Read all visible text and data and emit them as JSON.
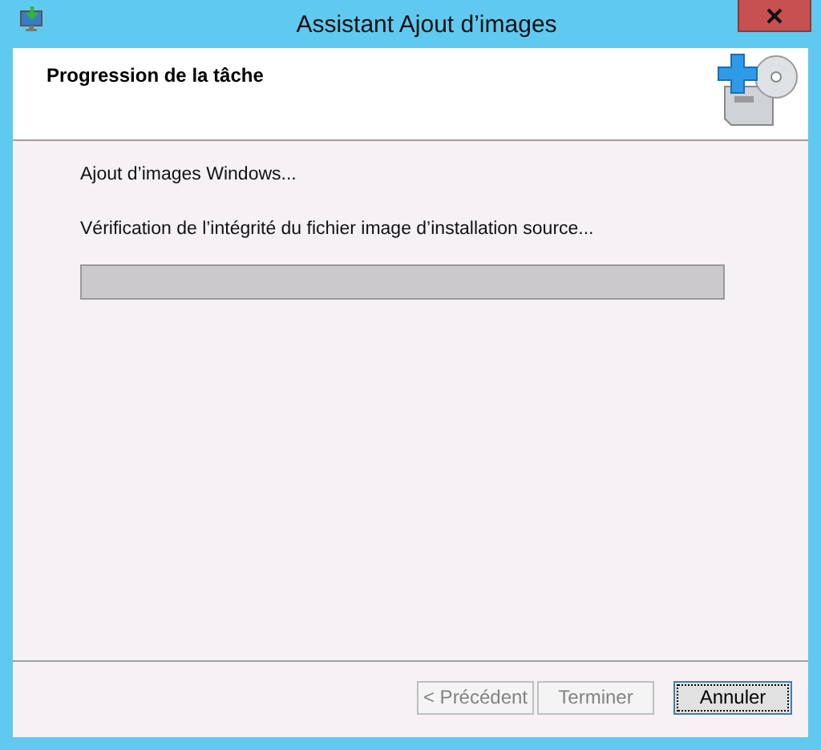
{
  "window": {
    "title": "Assistant Ajout d’images"
  },
  "header": {
    "title": "Progression de la tâche"
  },
  "body": {
    "status": "Ajout d’images Windows...",
    "task": "Vérification de l’intégrité du fichier image d’installation source...",
    "progress": {
      "level": 0
    }
  },
  "buttons": [
    {
      "label": "< Précédent",
      "disabled": true,
      "focused": false
    },
    {
      "label": "Terminer",
      "disabled": true,
      "focused": false
    },
    {
      "label": "Annuler",
      "disabled": false,
      "focused": true
    }
  ]
}
